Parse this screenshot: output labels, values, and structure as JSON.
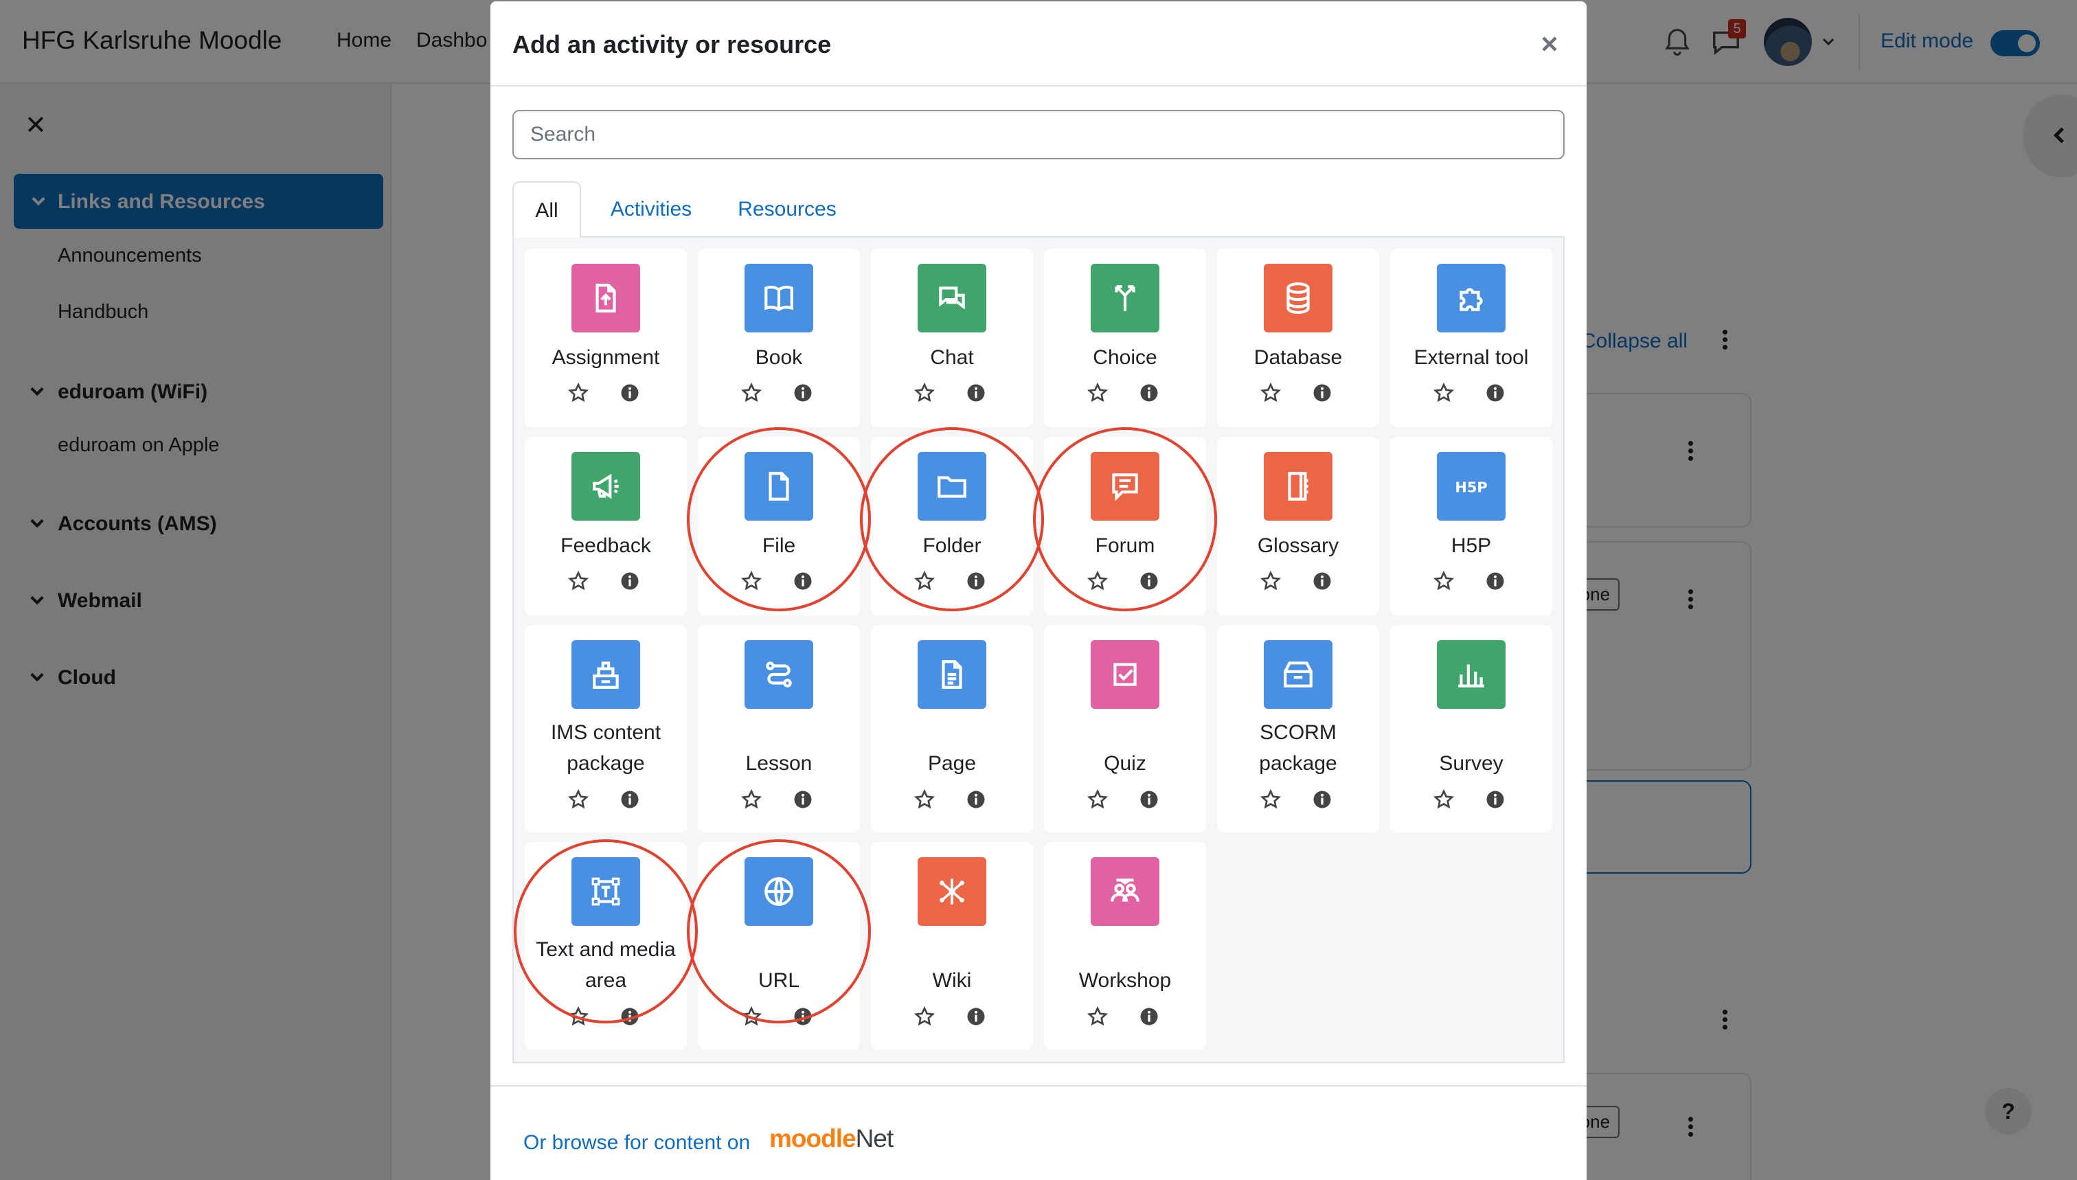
{
  "navbar": {
    "site_name": "HFG Karlsruhe Moodle",
    "links": [
      "Home",
      "Dashbo"
    ],
    "message_count": "5",
    "edit_mode_label": "Edit mode"
  },
  "drawer": {
    "active_section": "Links and Resources",
    "sections": [
      {
        "label": "Links and Resources",
        "items": [
          "Announcements",
          "Handbuch"
        ]
      },
      {
        "label": "eduroam (WiFi)",
        "items": [
          "eduroam on Apple"
        ]
      },
      {
        "label": "Accounts (AMS)",
        "items": []
      },
      {
        "label": "Webmail",
        "items": []
      },
      {
        "label": "Cloud",
        "items": []
      }
    ]
  },
  "background": {
    "collapse_all": "Collapse all",
    "done_labels": [
      "s done",
      "s done"
    ]
  },
  "modal": {
    "title": "Add an activity or resource",
    "search_placeholder": "Search",
    "tabs": [
      "All",
      "Activities",
      "Resources"
    ],
    "active_tab": "All",
    "footer_link": "Or browse for content on",
    "footer_logo": {
      "m": "moodle",
      "n": "Net"
    },
    "highlighted_items": [
      "File",
      "Folder",
      "Forum",
      "Text and media area",
      "URL"
    ],
    "items": [
      {
        "name": "Assignment",
        "icon": "assignment-icon",
        "color": "#e062a2"
      },
      {
        "name": "Book",
        "icon": "book-icon",
        "color": "#4a90e2"
      },
      {
        "name": "Chat",
        "icon": "chat-icon",
        "color": "#3fa56a"
      },
      {
        "name": "Choice",
        "icon": "choice-icon",
        "color": "#3fa56a"
      },
      {
        "name": "Database",
        "icon": "database-icon",
        "color": "#eb6547"
      },
      {
        "name": "External tool",
        "icon": "puzzle-icon",
        "color": "#4a90e2"
      },
      {
        "name": "Feedback",
        "icon": "megaphone-icon",
        "color": "#3fa56a"
      },
      {
        "name": "File",
        "icon": "file-icon",
        "color": "#4a90e2"
      },
      {
        "name": "Folder",
        "icon": "folder-icon",
        "color": "#4a90e2"
      },
      {
        "name": "Forum",
        "icon": "forum-icon",
        "color": "#eb6547"
      },
      {
        "name": "Glossary",
        "icon": "glossary-icon",
        "color": "#eb6547"
      },
      {
        "name": "H5P",
        "icon": "h5p-icon",
        "color": "#4a90e2"
      },
      {
        "name": "IMS content package",
        "icon": "package-icon",
        "color": "#4a90e2"
      },
      {
        "name": "Lesson",
        "icon": "lesson-icon",
        "color": "#4a90e2"
      },
      {
        "name": "Page",
        "icon": "page-icon",
        "color": "#4a90e2"
      },
      {
        "name": "Quiz",
        "icon": "quiz-icon",
        "color": "#e062a2"
      },
      {
        "name": "SCORM package",
        "icon": "scorm-icon",
        "color": "#4a90e2"
      },
      {
        "name": "Survey",
        "icon": "survey-icon",
        "color": "#3fa56a"
      },
      {
        "name": "Text and media area",
        "icon": "text-media-icon",
        "color": "#4a90e2"
      },
      {
        "name": "URL",
        "icon": "globe-icon",
        "color": "#4a90e2"
      },
      {
        "name": "Wiki",
        "icon": "wiki-icon",
        "color": "#eb6547"
      },
      {
        "name": "Workshop",
        "icon": "workshop-icon",
        "color": "#e062a2"
      }
    ]
  }
}
